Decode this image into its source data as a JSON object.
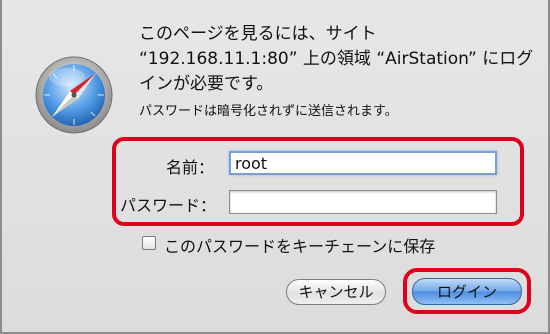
{
  "dialog": {
    "message_lines": [
      "このページを見るには、サイト",
      "“192.168.11.1:80” 上の領域 “AirStation” にログ",
      "インが必要です。"
    ],
    "note": "パスワードは暗号化されずに送信されます。"
  },
  "form": {
    "name_label": "名前：",
    "name_value": "root",
    "password_label": "パスワード：",
    "password_value": ""
  },
  "keychain": {
    "label": "このパスワードをキーチェーンに保存",
    "checked": false
  },
  "buttons": {
    "cancel_label": "キャンセル",
    "login_label": "ログイン"
  },
  "colors": {
    "highlight": "#e0001b",
    "default_button": "#4c8ce0"
  },
  "icons": {
    "app": "safari-compass-icon"
  }
}
